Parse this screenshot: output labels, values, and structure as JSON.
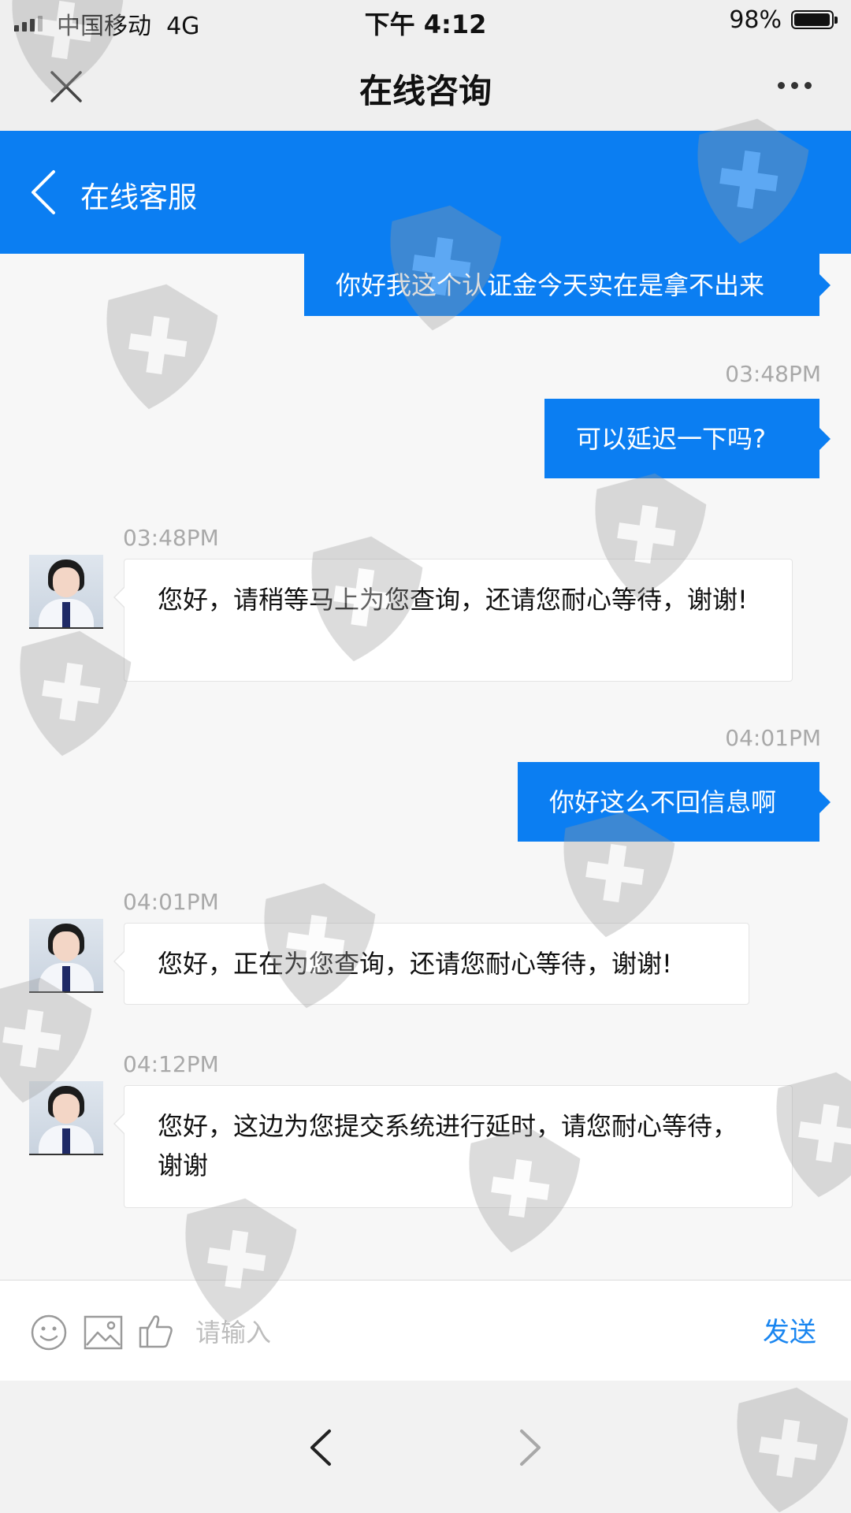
{
  "status_bar": {
    "carrier": "中国移动",
    "network": "4G",
    "time": "下午 4:12",
    "battery": "98%",
    "battery_level": 0.98
  },
  "titlebar": {
    "title": "在线咨询",
    "close_icon": "close-icon",
    "more_icon": "more-icon"
  },
  "chat_header": {
    "title": "在线客服",
    "back_icon": "chevron-left-icon"
  },
  "messages": [
    {
      "direction": "out",
      "time": "",
      "text": "你好我这个认证金今天实在是拿不出来"
    },
    {
      "direction": "out",
      "time": "03:48PM",
      "text": "可以延迟一下吗?"
    },
    {
      "direction": "in",
      "time": "03:48PM",
      "text": "您好，请稍等马上为您查询，还请您耐心等待，谢谢!"
    },
    {
      "direction": "out",
      "time": "04:01PM",
      "text": "你好这么不回信息啊"
    },
    {
      "direction": "in",
      "time": "04:01PM",
      "text": "您好，正在为您查询，还请您耐心等待，谢谢!"
    },
    {
      "direction": "in",
      "time": "04:12PM",
      "text": "您好，这边为您提交系统进行延时，请您耐心等待，谢谢"
    }
  ],
  "input_bar": {
    "placeholder": "请输入",
    "value": "",
    "send_label": "发送",
    "icons": [
      "emoji-icon",
      "image-icon",
      "thumbs-up-icon"
    ]
  },
  "bottom_nav": {
    "icons": [
      "chevron-left-icon",
      "chevron-right-icon"
    ]
  },
  "colors": {
    "brand_blue": "#0b7ef2",
    "send_blue": "#1a86f0",
    "timestamp_gray": "#a9a9a9"
  }
}
